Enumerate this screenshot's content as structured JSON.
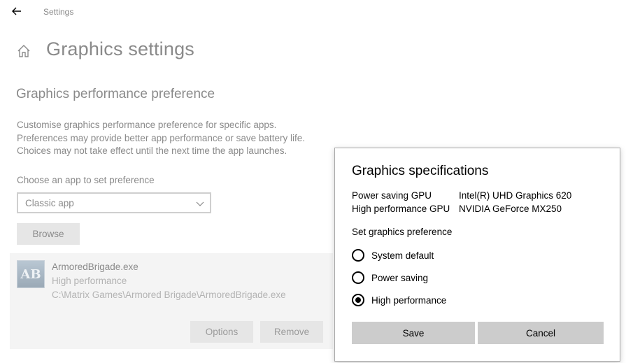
{
  "header": {
    "crumb": "Settings"
  },
  "page": {
    "title": "Graphics settings",
    "section_title": "Graphics performance preference",
    "description": [
      "Customise graphics performance preference for specific apps.",
      "Preferences may provide better app performance or save battery life.",
      "Choices may not take effect until the next time the app launches."
    ],
    "choose_label": "Choose an app to set preference",
    "select_value": "Classic app",
    "browse_label": "Browse"
  },
  "app": {
    "icon_text": "AB",
    "name": "ArmoredBrigade.exe",
    "preference": "High performance",
    "path": "C:\\Matrix Games\\Armored Brigade\\ArmoredBrigade.exe",
    "options_label": "Options",
    "remove_label": "Remove"
  },
  "dialog": {
    "title": "Graphics specifications",
    "specs": [
      {
        "label": "Power saving GPU",
        "value": "Intel(R) UHD Graphics 620"
      },
      {
        "label": "High performance GPU",
        "value": "NVIDIA GeForce MX250"
      }
    ],
    "pref_label": "Set graphics preference",
    "options": [
      {
        "label": "System default",
        "checked": false
      },
      {
        "label": "Power saving",
        "checked": false
      },
      {
        "label": "High performance",
        "checked": true
      }
    ],
    "save_label": "Save",
    "cancel_label": "Cancel"
  }
}
